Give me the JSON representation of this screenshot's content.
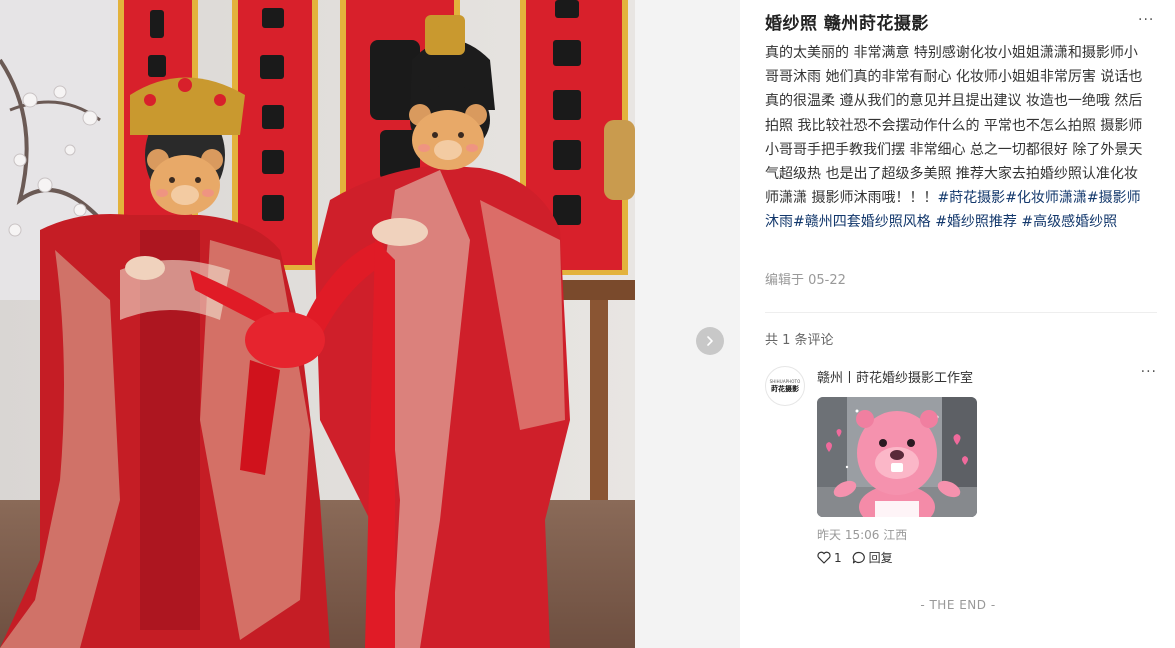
{
  "post": {
    "title": "婚纱照 赣州莳花摄影",
    "body_text": "真的太美丽的 非常满意 特别感谢化妆小姐姐潇潇和摄影师小哥哥沐雨 她们真的非常有耐心 化妆师小姐姐非常厉害 说话也真的很温柔 遵从我们的意见并且提出建议 妆造也一绝哦 然后拍照 我比较社恐不会摆动作什么的 平常也不怎么拍照 摄影师小哥哥手把手教我们摆  非常细心 总之一切都很好 除了外景天气超级热 也是出了超级多美照 推荐大家去拍婚纱照认准化妆师潇潇 摄影师沐雨哦！！！",
    "tags": [
      "#莳花摄影",
      "#化妆师潇潇",
      "#摄影师沐雨",
      "#赣州四套婚纱照风格",
      "#婚纱照推荐",
      "#高级感婚纱照"
    ],
    "edited": "编辑于 05-22"
  },
  "comments_header": "共 1 条评论",
  "comment": {
    "author": "赣州丨莳花婚纱摄影工作室",
    "avatar_top": "SHIHUAPHOTO",
    "avatar_text": "莳花摄影",
    "time": "昨天 15:06",
    "location": "江西",
    "likes": "1",
    "reply_label": "回复",
    "more": "···",
    "sticker_icon": "pink-beaver-sticker"
  },
  "end_text": "- THE END -",
  "more_label": "···",
  "photo_icon": "wedding-couple-photo",
  "colors": {
    "tag": "#13386c",
    "meta": "#999999",
    "title": "#222222"
  }
}
